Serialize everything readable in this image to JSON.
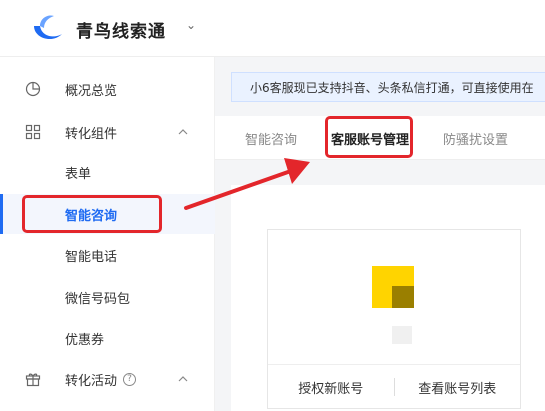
{
  "header": {
    "brand": "青鸟线索通",
    "caret": "⌄"
  },
  "sidebar": {
    "items": [
      {
        "label": "概况总览"
      },
      {
        "label": "转化组件"
      },
      {
        "label": "表单"
      },
      {
        "label": "智能咨询"
      },
      {
        "label": "智能电话"
      },
      {
        "label": "微信号码包"
      },
      {
        "label": "优惠券"
      },
      {
        "label": "转化活动"
      }
    ],
    "help_glyph": "?"
  },
  "main": {
    "notice": "小6客服现已支持抖音、头条私信打通，可直接使用在",
    "tabs": [
      {
        "label": "智能咨询"
      },
      {
        "label": "客服账号管理"
      },
      {
        "label": "防骚扰设置"
      }
    ],
    "card": {
      "authorize_label": "授权新账号",
      "list_label": "查看账号列表"
    }
  },
  "colors": {
    "accent": "#1f6bf2",
    "highlight": "#e3262b"
  }
}
